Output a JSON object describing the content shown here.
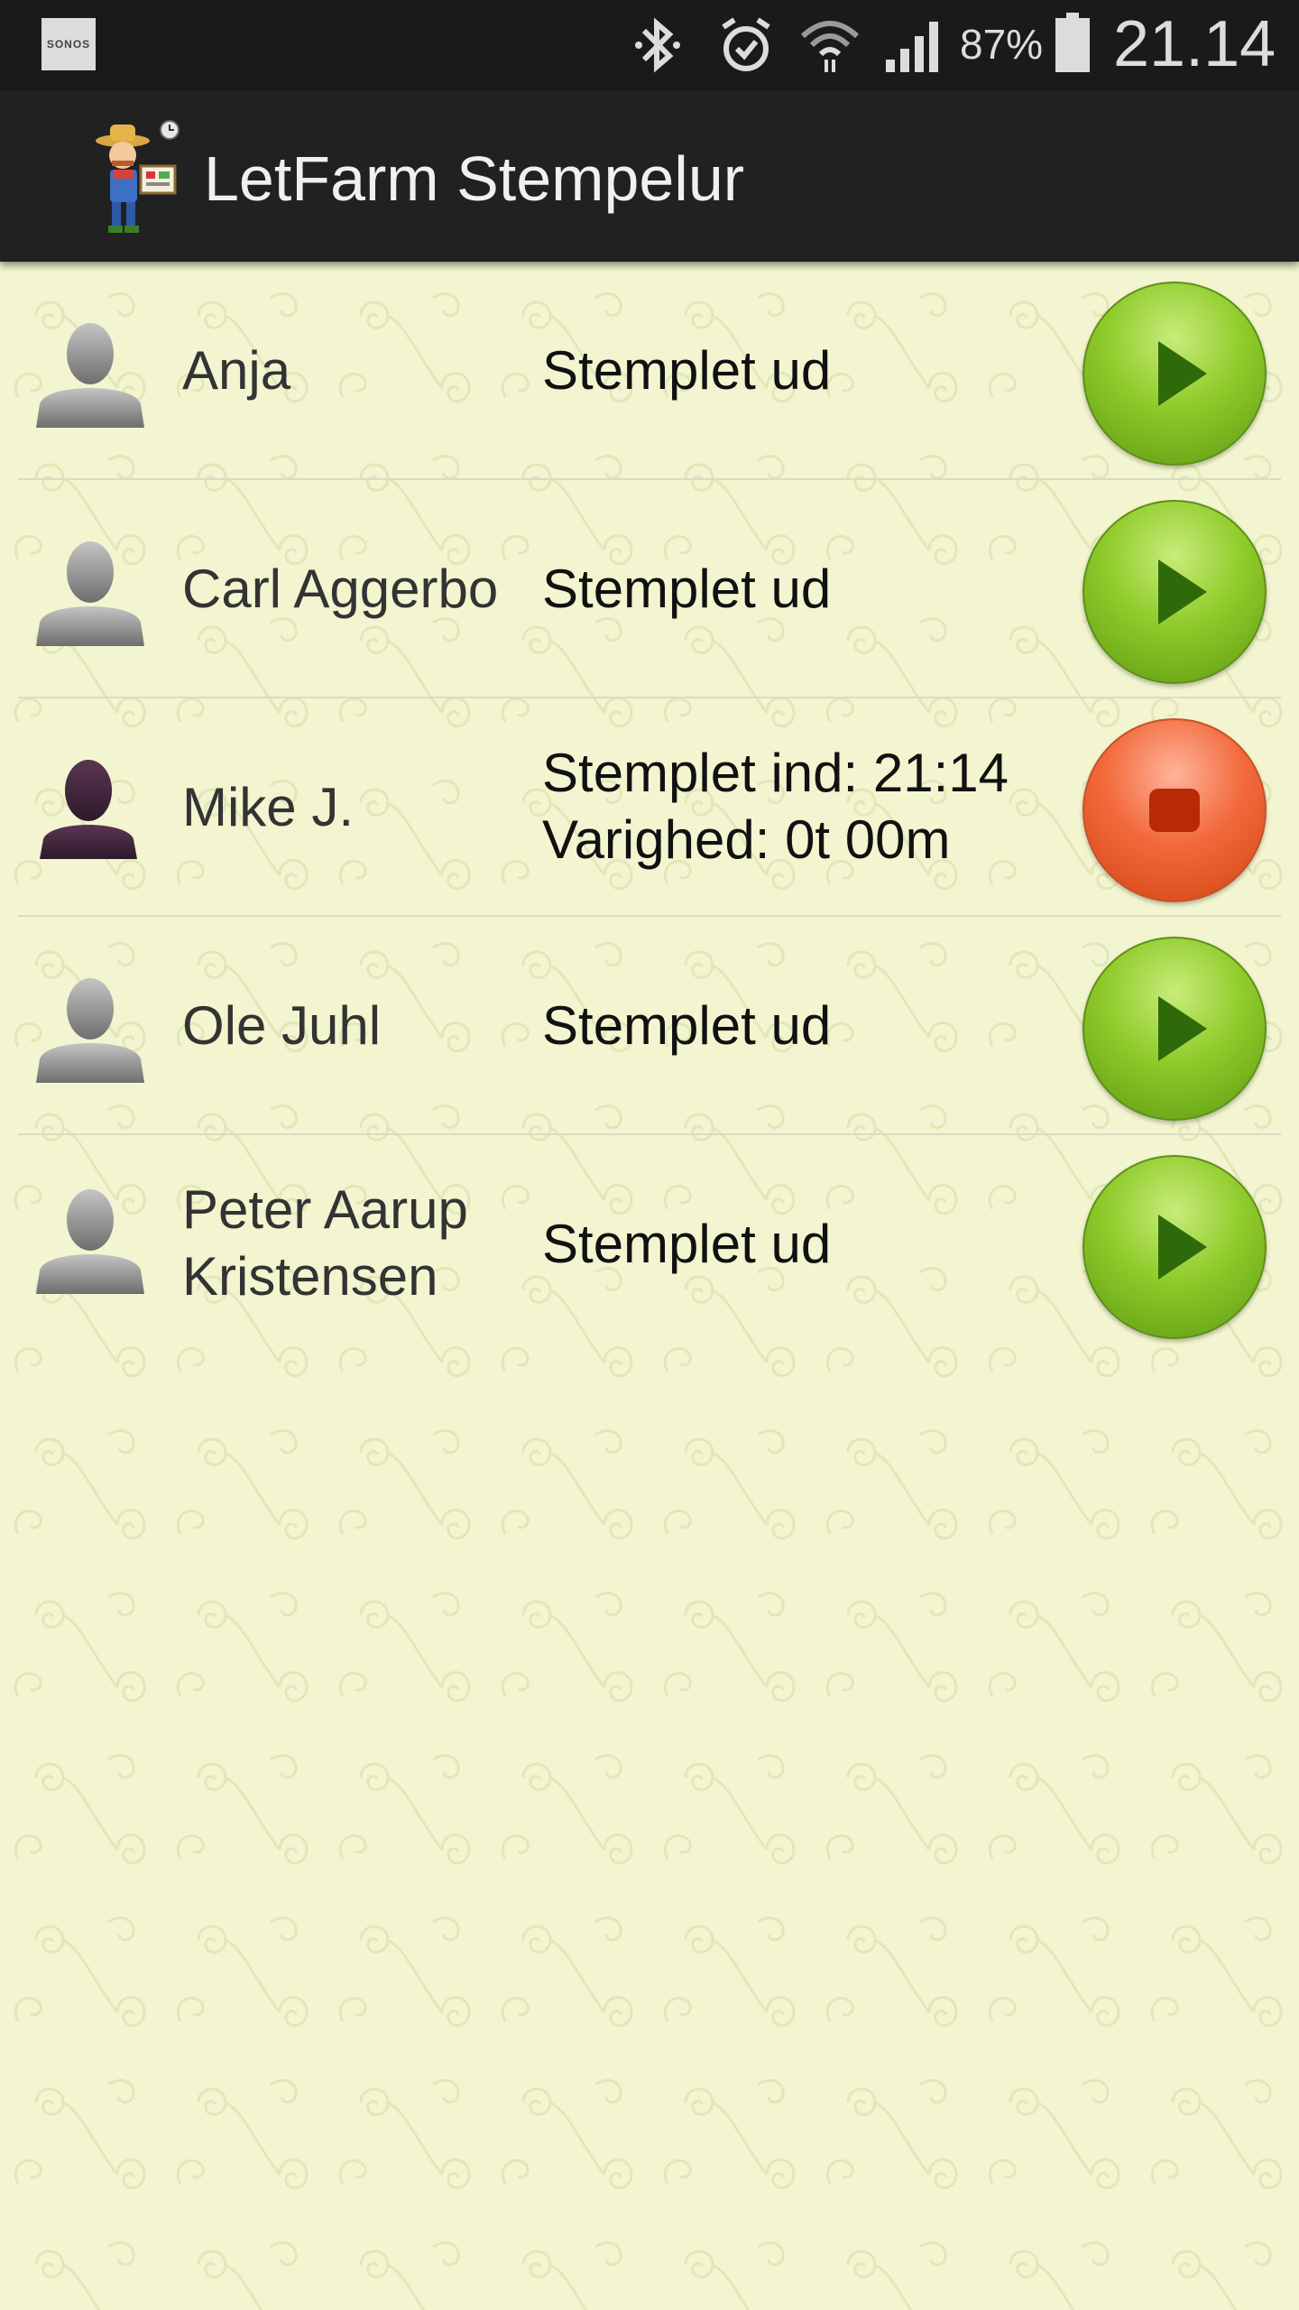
{
  "status_bar": {
    "notification_label": "SONOS",
    "battery_percent": "87%",
    "time": "21.14",
    "icons": [
      "bluetooth-icon",
      "alarm-icon",
      "wifi-icon",
      "signal-icon",
      "battery-icon"
    ]
  },
  "action_bar": {
    "title": "LetFarm Stempelur",
    "logo_icon": "farmer-logo-icon"
  },
  "employees": [
    {
      "name": "Anja",
      "status": "Stemplet ud",
      "status_line2": "",
      "state": "out",
      "button": "play"
    },
    {
      "name": "Carl Aggerbo",
      "status": "Stemplet ud",
      "status_line2": "",
      "state": "out",
      "button": "play"
    },
    {
      "name": "Mike J.",
      "status": "Stemplet ind: 21:14",
      "status_line2": "Varighed: 0t 00m",
      "state": "in",
      "button": "stop"
    },
    {
      "name": "Ole Juhl",
      "status": "Stemplet ud",
      "status_line2": "",
      "state": "out",
      "button": "play"
    },
    {
      "name": "Peter Aarup Kristensen",
      "status": "Stemplet ud",
      "status_line2": "",
      "state": "out",
      "button": "play"
    }
  ],
  "colors": {
    "background": "#f2f5cf",
    "action_bar": "#212121",
    "play_button": "#8fcb2a",
    "stop_button": "#f26a3c",
    "avatar_out": "#8a8a8a",
    "avatar_in": "#4a2a45"
  }
}
